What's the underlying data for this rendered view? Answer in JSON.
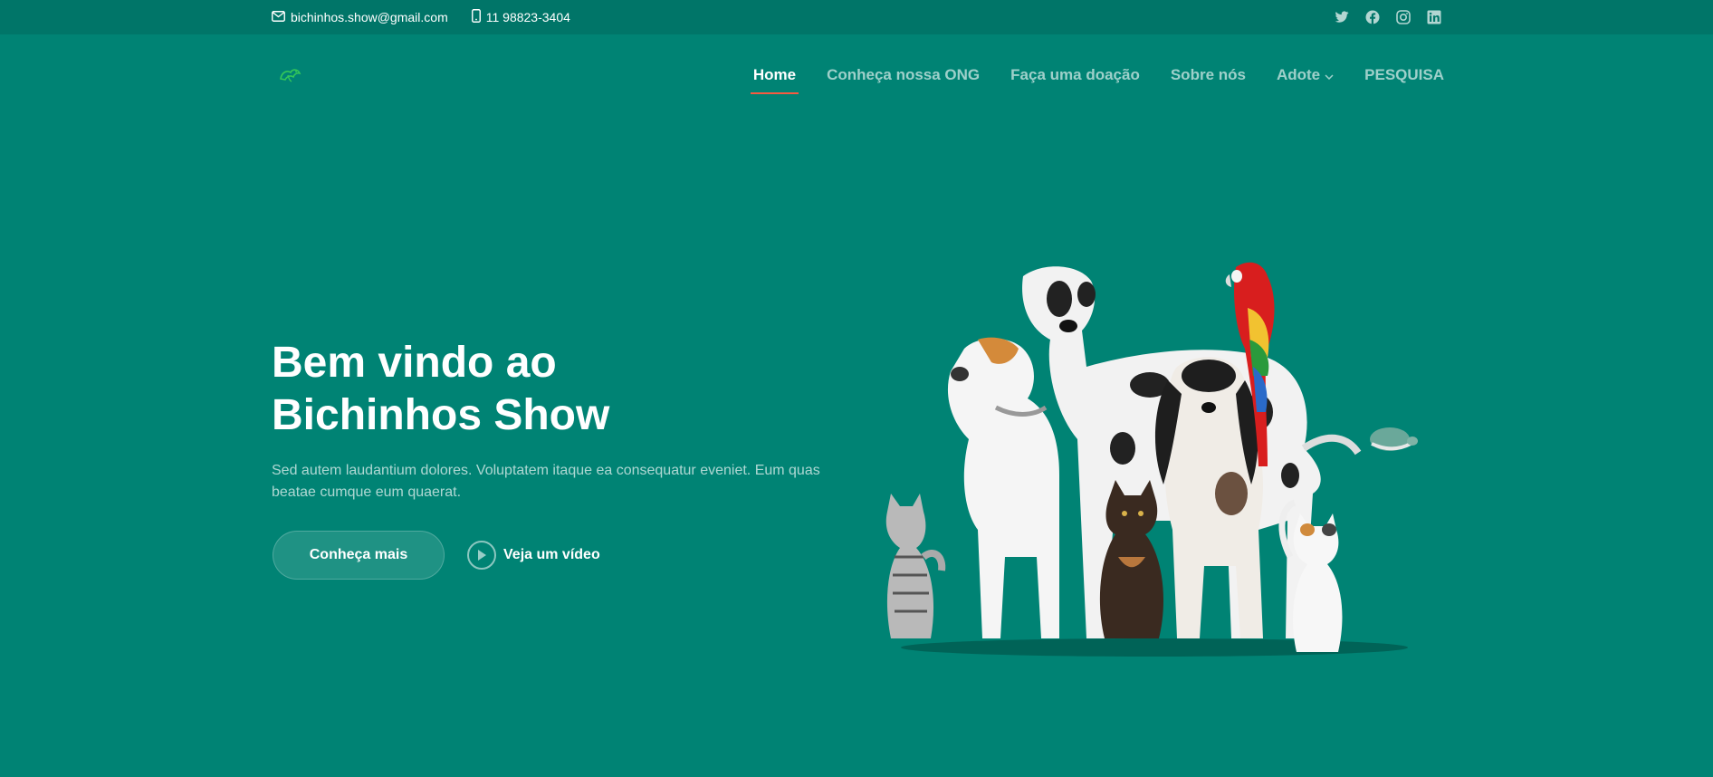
{
  "topbar": {
    "email": "bichinhos.show@gmail.com",
    "phone": "11 98823-3404",
    "social": [
      "twitter-icon",
      "facebook-icon",
      "instagram-icon",
      "linkedin-icon"
    ]
  },
  "nav": {
    "items": [
      {
        "label": "Home",
        "active": true
      },
      {
        "label": "Conheça nossa ONG"
      },
      {
        "label": "Faça uma doação"
      },
      {
        "label": "Sobre nós"
      },
      {
        "label": "Adote",
        "dropdown": true
      },
      {
        "label": "PESQUISA"
      }
    ]
  },
  "hero": {
    "title_line1": "Bem vindo ao",
    "title_line2": "Bichinhos Show",
    "subtitle": "Sed autem laudantium dolores. Voluptatem itaque ea consequatur eveniet. Eum quas beatae cumque eum quaerat.",
    "cta_primary": "Conheça mais",
    "cta_video": "Veja um vídeo"
  },
  "colors": {
    "background": "#008374",
    "topbar": "#007568",
    "accent": "#f85a40"
  }
}
